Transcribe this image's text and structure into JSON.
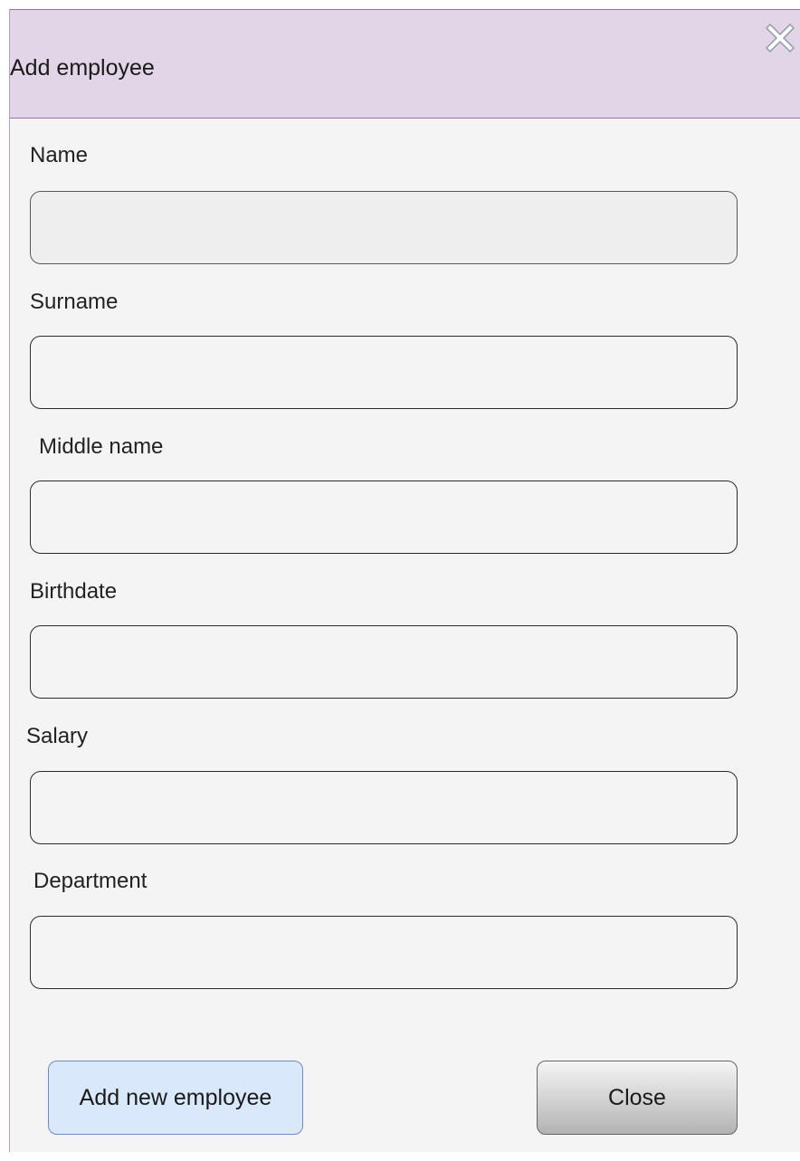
{
  "dialog": {
    "title": "Add employee"
  },
  "fields": [
    {
      "label": "Name",
      "value": "",
      "state": "disabled"
    },
    {
      "label": "Surname",
      "value": ""
    },
    {
      "label": "Middle name",
      "value": ""
    },
    {
      "label": "Birthdate",
      "value": ""
    },
    {
      "label": "Salary",
      "value": ""
    },
    {
      "label": "Department",
      "value": ""
    }
  ],
  "buttons": {
    "add_label": "Add new employee",
    "close_label": "Close"
  },
  "icons": {
    "close": "close-icon"
  },
  "colors": {
    "titlebar_bg": "#e1d5e7",
    "titlebar_border": "#9673a6",
    "add_button_bg": "#dae8fc",
    "add_button_border": "#6c8ebf"
  }
}
